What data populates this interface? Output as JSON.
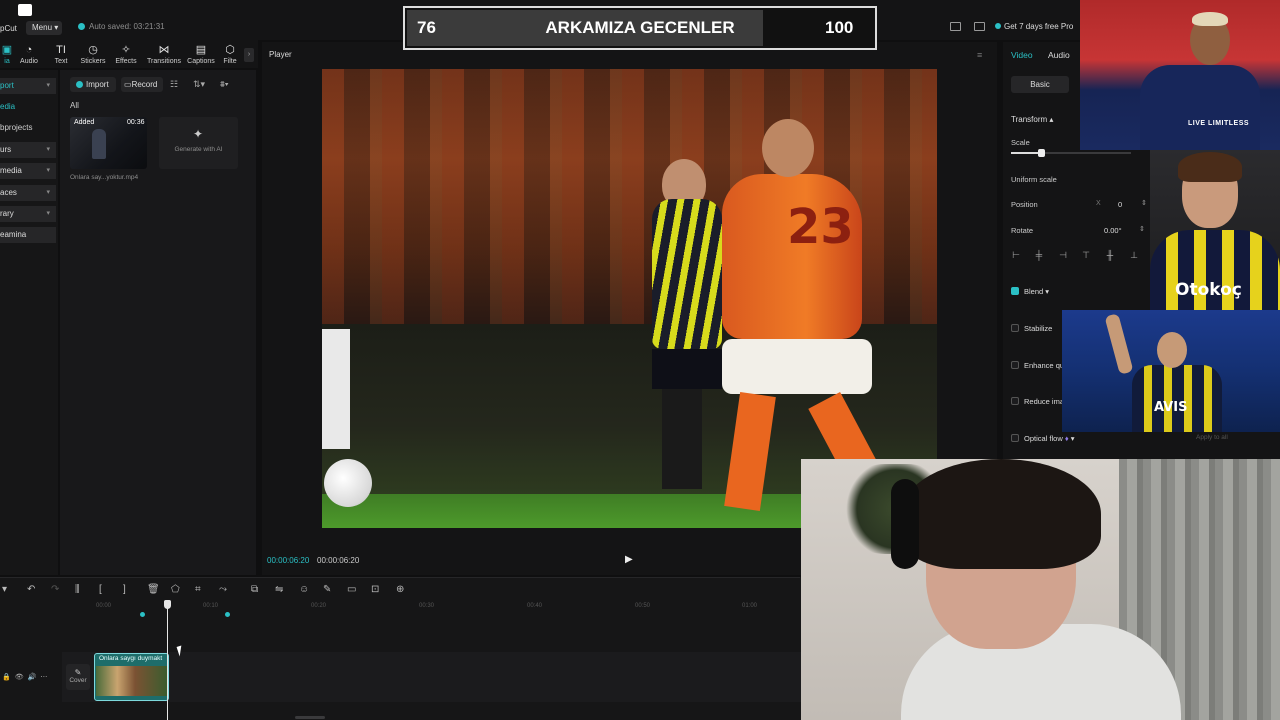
{
  "app": {
    "name": "pCut",
    "menu_label": "Menu",
    "autosave": "Auto saved: 03:21:31",
    "pro_message": "Get 7 days free Pro"
  },
  "scoreboard": {
    "left_score": "76",
    "title": "ARKAMIZA GECENLER",
    "right_score": "100"
  },
  "toolbar": {
    "items": [
      {
        "label": "ia",
        "icon": "media-icon"
      },
      {
        "label": "Audio",
        "icon": "audio-icon"
      },
      {
        "label": "Text",
        "icon": "text-icon"
      },
      {
        "label": "Stickers",
        "icon": "stickers-icon"
      },
      {
        "label": "Effects",
        "icon": "effects-icon"
      },
      {
        "label": "Transitions",
        "icon": "transitions-icon"
      },
      {
        "label": "Captions",
        "icon": "captions-icon"
      },
      {
        "label": "Filte",
        "icon": "filters-icon"
      }
    ],
    "collapse": "›"
  },
  "sidebar": {
    "items": [
      {
        "label": "port"
      },
      {
        "label": "edia"
      },
      {
        "label": "bprojects"
      },
      {
        "label": "urs"
      },
      {
        "label": "media"
      },
      {
        "label": "aces"
      },
      {
        "label": "rary"
      },
      {
        "label": "eamina"
      }
    ]
  },
  "media": {
    "import_label": "Import",
    "record_label": "Record",
    "all_label": "All",
    "item": {
      "status": "Added",
      "duration": "00:36",
      "filename": "Onlara say...yoktur.mp4"
    },
    "generate_label": "Generate with AI"
  },
  "player": {
    "label": "Player",
    "current_time": "00:00:06:20",
    "total_time": "00:00:06:20",
    "jersey_number": "23"
  },
  "inspector": {
    "tabs": [
      "Video",
      "Audio"
    ],
    "basic_label": "Basic",
    "transform_label": "Transform",
    "scale_label": "Scale",
    "scale_level": 0.25,
    "uniform_scale_label": "Uniform scale",
    "position_label": "Position",
    "position_x_label": "X",
    "position_x_value": "0",
    "rotate_label": "Rotate",
    "rotate_value": "0.00°",
    "options": [
      {
        "label": "Blend",
        "checked": true
      },
      {
        "label": "Stabilize",
        "checked": false
      },
      {
        "label": "Enhance qu",
        "checked": false
      },
      {
        "label": "Reduce ima",
        "checked": false
      },
      {
        "label": "Optical flow",
        "checked": false
      }
    ],
    "apply_all": "Apply to all"
  },
  "overlays": {
    "neymar_text": "LIVE LIMITLESS",
    "kent_text": "Otokoç",
    "valbuena_text": "AVIS"
  },
  "timeline": {
    "ticks": [
      "00:00",
      "00:10",
      "00:20",
      "00:30",
      "00:40",
      "00:50",
      "01:00"
    ],
    "cover_label": "Cover",
    "clip_label": "Onlara saygı duymakt"
  },
  "colors": {
    "accent": "#2bc0c5",
    "background": "#0f0f10"
  }
}
